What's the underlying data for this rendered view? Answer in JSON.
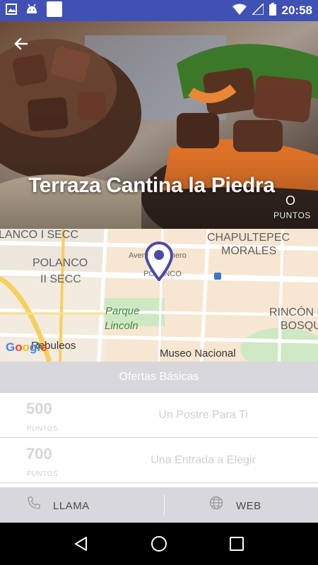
{
  "status_bar": {
    "time": "20:58",
    "left_icons": [
      "image-icon",
      "android-icon",
      "blank-square-icon"
    ],
    "right_icons": [
      "wifi-icon",
      "signal-icon",
      "battery-icon"
    ]
  },
  "hero": {
    "title": "Terraza Cantina la Piedra",
    "points_value": "O",
    "points_label": "PUNTOS"
  },
  "map": {
    "labels": {
      "polanco_i": "LANCO I SECC",
      "chapultepec": "CHAPULTEPEC",
      "morales": "MORALES",
      "avenida": "Avenida Homero",
      "polanco": "POLANCO",
      "polanco_ii_a": "POLANCO",
      "polanco_ii_b": "II SECC",
      "parque_a": "Parque",
      "parque_b": "Lincoln",
      "rincon_a": "RINCÓN D",
      "rincon_b": "BOSQU",
      "museo": "Museo Nacional",
      "rebuleos": "Rebuleos"
    },
    "metro_badge": "M",
    "google_letters": [
      "G",
      "o",
      "o",
      "g",
      "l",
      "e"
    ]
  },
  "section": {
    "title": "Ofertas Básicas"
  },
  "offers": [
    {
      "points": "500",
      "points_label": "PUNTOS",
      "title": "Un Postre Para Ti"
    },
    {
      "points": "700",
      "points_label": "PUNTOS",
      "title": "Una Entrada a Elegir"
    }
  ],
  "actions": {
    "call_label": "LLAMA",
    "web_label": "WEB"
  },
  "colors": {
    "status_bar": "#3f51b5",
    "pin": "#4a4aa8",
    "section_bg": "#d8d8dc"
  }
}
